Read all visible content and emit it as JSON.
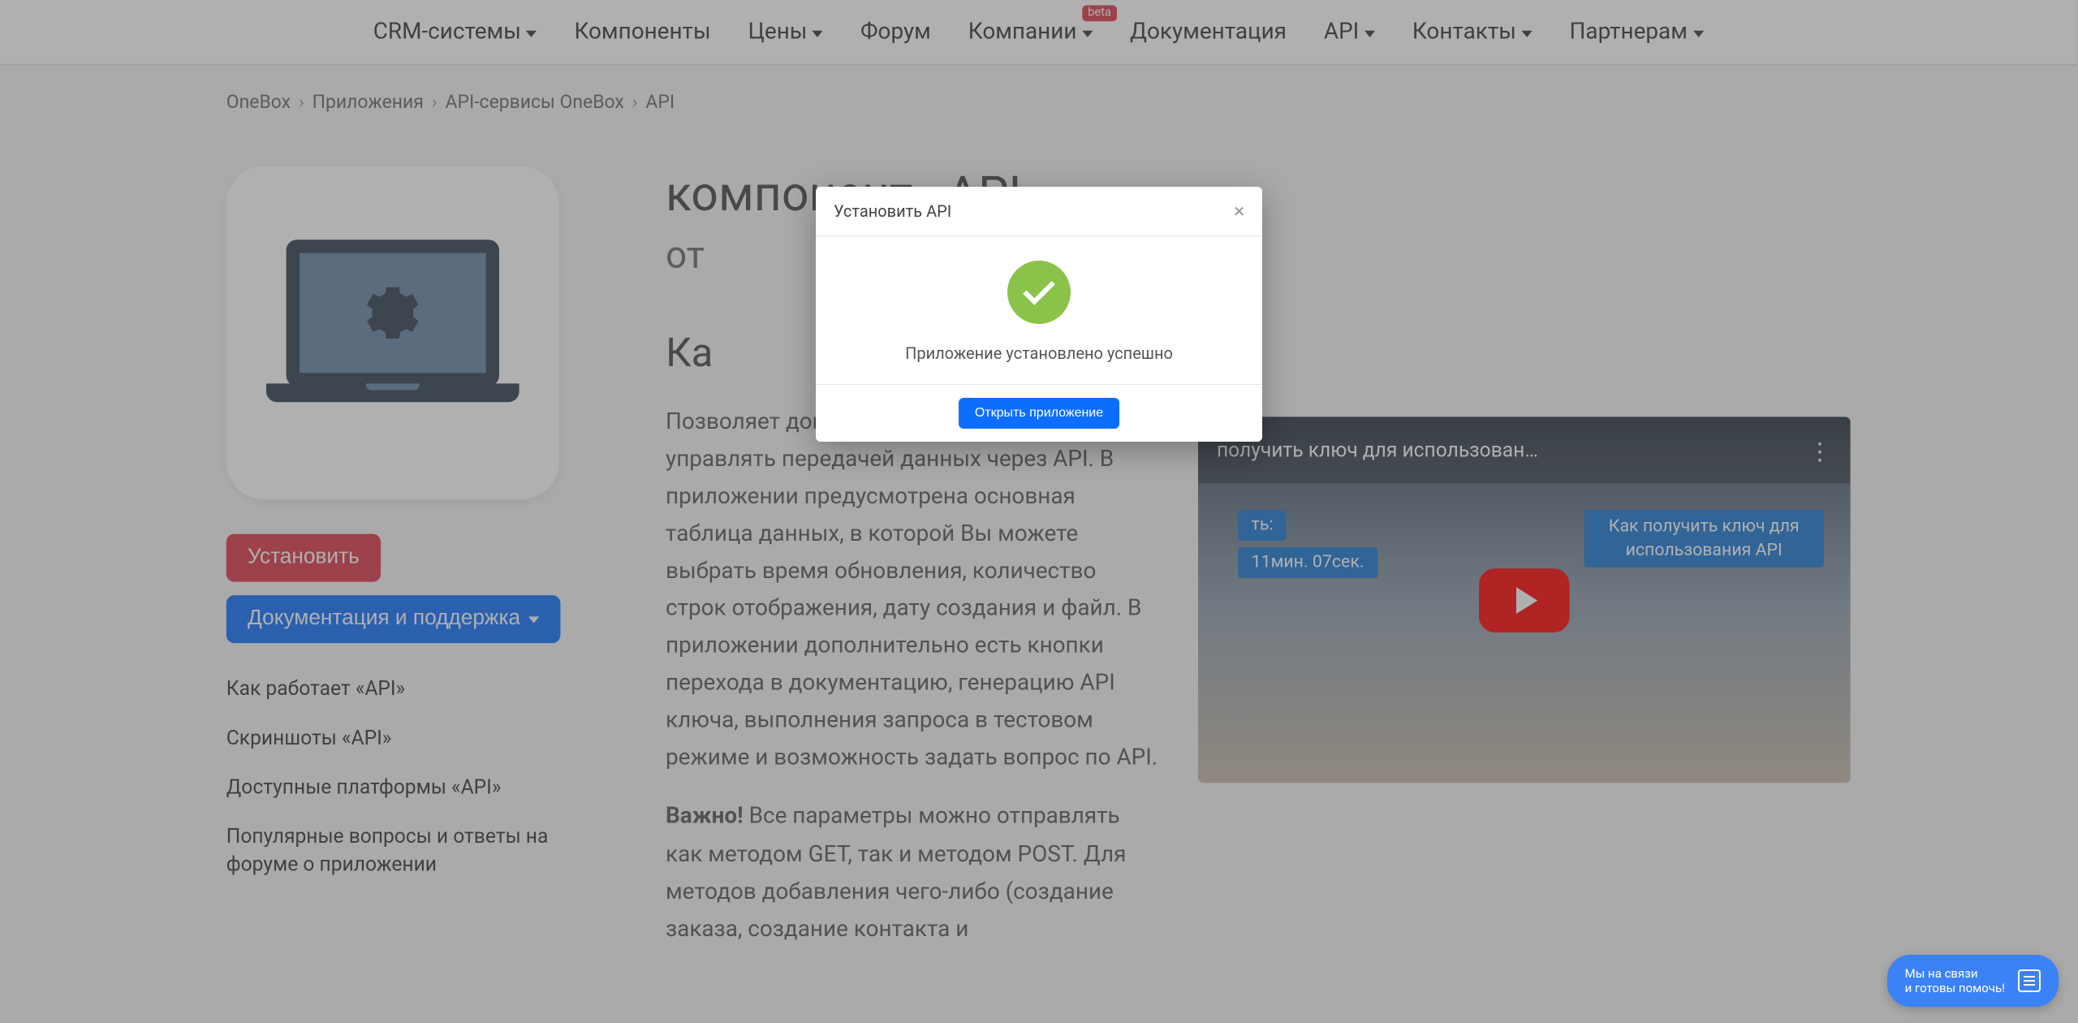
{
  "nav": [
    "CRM-системы",
    "Компоненты",
    "Цены",
    "Форум",
    "Компании",
    "Документация",
    "API",
    "Контакты",
    "Партнерам"
  ],
  "nav_caret": [
    true,
    false,
    true,
    false,
    true,
    false,
    true,
    true,
    true
  ],
  "beta_label": "beta",
  "breadcrumb": [
    "OneBox",
    "Приложения",
    "API-сервисы OneBox",
    "API"
  ],
  "sidebar": {
    "install": "Установить",
    "docs": "Документация и поддержка",
    "links": [
      "Как работает «API»",
      "Скриншоты «API»",
      "Доступные платформы «API»",
      "Популярные вопросы и ответы на форуме о приложении"
    ]
  },
  "page": {
    "title": "компонент «API»",
    "from_prefix": "от",
    "how_title": "Ка",
    "para1": "Позволяет дополнительно отображать и управлять передачей данных через API. В приложении предусмотрена основная таблица данных, в которой Вы можете выбрать время обновления, количество строк отображения, дату создания и файл. В приложении дополнительно есть кнопки перехода в документацию, генерацию API ключа, выполнения запроса в тестовом режиме и возможность задать вопрос по API.",
    "para2_strong": "Важно!",
    "para2": " Все параметры можно отправлять как методом GET, так и методом POST. Для методов добавления чего-либо (создание заказа, создание контакта и"
  },
  "video": {
    "title": "получить ключ для использован…",
    "tag_len_label": "ть:",
    "tag_len": "11мин. 07сек.",
    "tag_title": "Как получить ключ для использования API"
  },
  "modal": {
    "title": "Установить API",
    "message": "Приложение установлено успешно",
    "open": "Открыть приложение"
  },
  "chat": {
    "line1": "Мы на связи",
    "line2": "и готовы помочь!"
  }
}
